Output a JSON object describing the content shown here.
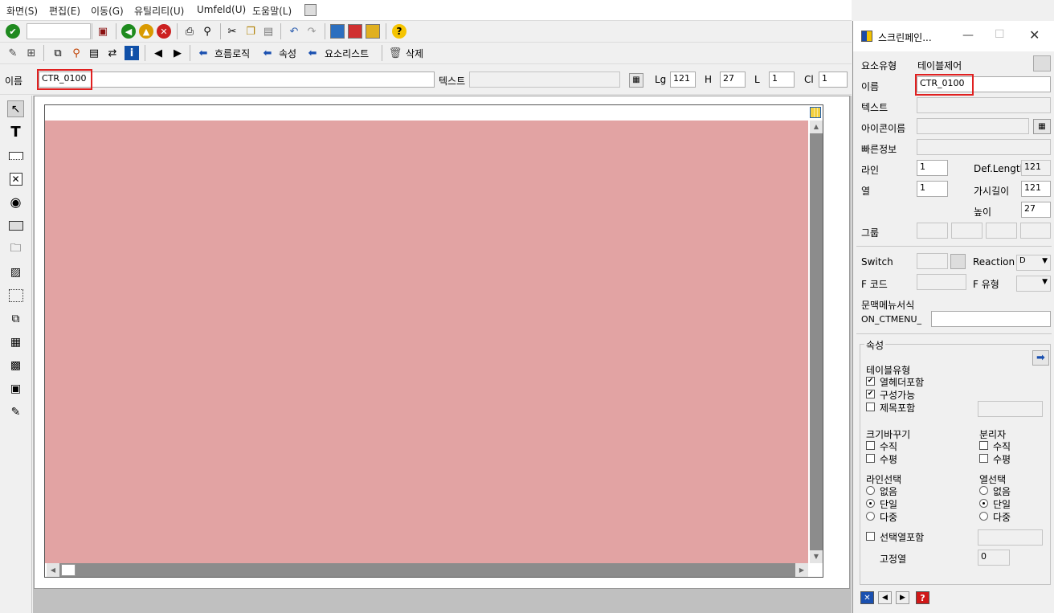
{
  "menu": [
    "화면(S)",
    "편집(E)",
    "이동(G)",
    "유틸리티(U)",
    "Umfeld(U)",
    "도움말(L)"
  ],
  "toolbar2": {
    "flow_logic": "흐름로직",
    "attributes": "속성",
    "element_list": "요소리스트",
    "delete": "삭제"
  },
  "namebar": {
    "name_label": "이름",
    "name_value": "CTR_0100",
    "text_label": "텍스트",
    "text_value": "",
    "lg_label": "Lg",
    "lg_value": "121",
    "h_label": "H",
    "h_value": "27",
    "l_label": "L",
    "l_value": "1",
    "cl_label": "Cl",
    "cl_value": "1"
  },
  "toolbox": [
    "pointer-icon",
    "text-field-icon",
    "input-field-icon",
    "checkbox-icon",
    "radio-icon",
    "pushbutton-icon",
    "tabstrip-icon",
    "tabstrip-wizard-icon",
    "box-icon",
    "subscreen-icon",
    "table-control-icon",
    "table-wizard-icon",
    "custom-control-icon",
    "status-icon"
  ],
  "canvas": {
    "table_color": "#e2a3a3"
  },
  "panel": {
    "title": "스크린페인...",
    "element_type_label": "요소유형",
    "element_type_value": "테이블제어",
    "name_label": "이름",
    "name_value": "CTR_0100",
    "text_label": "텍스트",
    "text_value": "",
    "icon_name_label": "아이콘이름",
    "icon_name_value": "",
    "quickinfo_label": "빠른정보",
    "quickinfo_value": "",
    "line_label": "라인",
    "line_value": "1",
    "col_label": "열",
    "col_value": "1",
    "deflen_label": "Def.Lengtl",
    "deflen_value": "121",
    "vislen_label": "가시길이",
    "vislen_value": "121",
    "height_label": "높이",
    "height_value": "27",
    "group_label": "그룹",
    "switch_label": "Switch",
    "reaction_label": "Reaction",
    "reaction_value": "D",
    "fcode_label": "F 코드",
    "ftype_label": "F 유형",
    "ctx_menu_label": "문맥메뉴서식",
    "ctx_menu_prefix": "ON_CTMENU_",
    "ctx_menu_value": "",
    "attrs_group_label": "속성",
    "table_type_label": "테이블유형",
    "col_header_label": "열헤더포함",
    "configurable_label": "구성가능",
    "title_incl_label": "제목포함",
    "resize_label": "크기바꾸기",
    "resize_v": "수직",
    "resize_h": "수평",
    "separator_label": "분리자",
    "sep_v": "수직",
    "sep_h": "수평",
    "line_sel_label": "라인선택",
    "col_sel_label": "열선택",
    "sel_none": "없음",
    "sel_single": "단일",
    "sel_multi": "다중",
    "sel_col_incl_label": "선택열포함",
    "fixed_col_label": "고정열",
    "fixed_col_value": "0"
  }
}
